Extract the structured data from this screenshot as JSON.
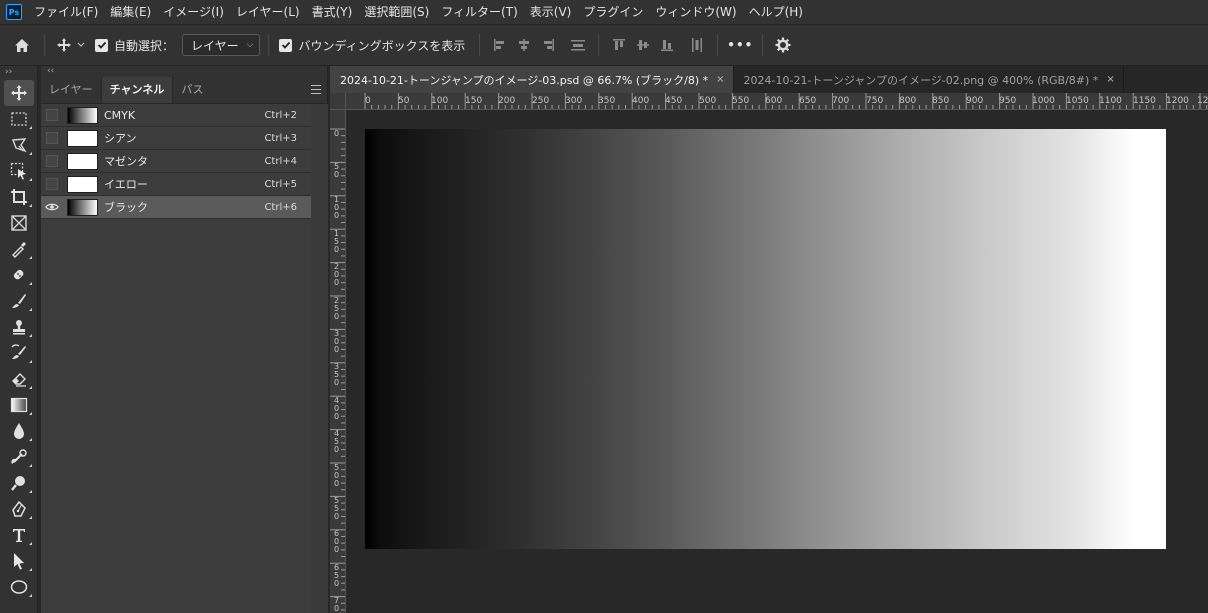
{
  "app": {
    "logo": "Ps"
  },
  "menu": [
    "ファイル(F)",
    "編集(E)",
    "イメージ(I)",
    "レイヤー(L)",
    "書式(Y)",
    "選択範囲(S)",
    "フィルター(T)",
    "表示(V)",
    "プラグイン",
    "ウィンドウ(W)",
    "ヘルプ(H)"
  ],
  "options": {
    "auto_select_label": "自動選択：",
    "auto_select_target": "レイヤー",
    "bounding_box_label": "バウンディングボックスを表示",
    "more": "•••"
  },
  "panel": {
    "collapse_left": "››",
    "collapse_right": "‹‹",
    "tabs": [
      "レイヤー",
      "チャンネル",
      "パス"
    ],
    "active_tab": 1,
    "channels": [
      {
        "name": "CMYK",
        "shortcut": "Ctrl+2",
        "thumb": "gradient",
        "visible": false
      },
      {
        "name": "シアン",
        "shortcut": "Ctrl+3",
        "thumb": "white",
        "visible": false
      },
      {
        "name": "マゼンタ",
        "shortcut": "Ctrl+4",
        "thumb": "white",
        "visible": false
      },
      {
        "name": "イエロー",
        "shortcut": "Ctrl+5",
        "thumb": "white",
        "visible": false
      },
      {
        "name": "ブラック",
        "shortcut": "Ctrl+6",
        "thumb": "gradient",
        "visible": true
      }
    ]
  },
  "documents": [
    {
      "title": "2024-10-21-トーンジャンプのイメージ-03.psd @ 66.7% (ブラック/8) *",
      "close": "×",
      "active": true
    },
    {
      "title": "2024-10-21-トーンジャンプのイメージ-02.png @ 400% (RGB/8#) *",
      "close": "×",
      "active": false
    }
  ],
  "ruler": {
    "top": [
      "0",
      "50",
      "100",
      "150",
      "200",
      "250",
      "300",
      "350",
      "400",
      "450",
      "500",
      "550",
      "600",
      "650",
      "700",
      "750",
      "800",
      "850",
      "900",
      "950",
      "1000",
      "1050",
      "1100",
      "1150",
      "1200",
      "12"
    ],
    "left": [
      "0",
      "50",
      "100",
      "150",
      "200",
      "250",
      "300",
      "350",
      "400",
      "450",
      "500",
      "550",
      "600",
      "650",
      "70"
    ]
  },
  "colors": {
    "accent": "#31a8ff",
    "panel_bg": "#3c3c3c",
    "chrome_bg": "#323232"
  },
  "tools": [
    "move-tool",
    "marquee-tool",
    "lasso-tool",
    "object-select-tool",
    "crop-tool",
    "frame-tool",
    "eyedropper-tool",
    "healing-brush-tool",
    "brush-tool",
    "clone-stamp-tool",
    "history-brush-tool",
    "eraser-tool",
    "gradient-tool",
    "blur-tool",
    "dodge-tool",
    "zoom-tool",
    "pen-tool",
    "type-tool",
    "path-select-tool",
    "ellipse-tool"
  ]
}
